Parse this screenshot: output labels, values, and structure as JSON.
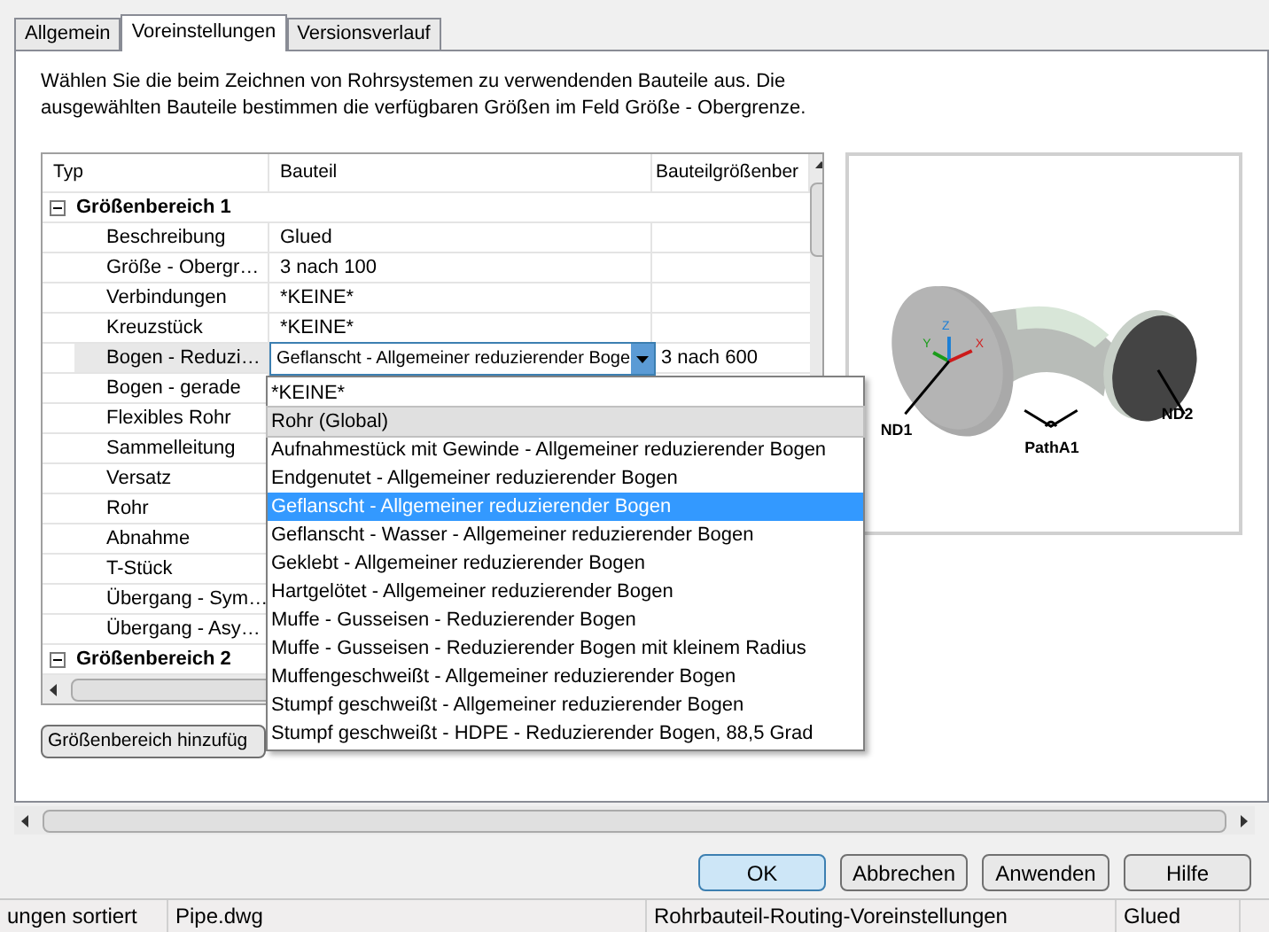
{
  "tabs": [
    {
      "label": "Allgemein",
      "selected": false
    },
    {
      "label": "Voreinstellungen",
      "selected": true
    },
    {
      "label": "Versionsverlauf",
      "selected": false
    }
  ],
  "description": "Wählen Sie die beim Zeichnen von Rohrsystemen zu verwendenden Bauteile aus. Die ausgewählten Bauteile bestimmen die verfügbaren Größen im Feld Größe - Obergrenze.",
  "grid": {
    "columns": [
      "Typ",
      "Bauteil",
      "Bauteilgrößenber"
    ],
    "groups": [
      {
        "label": "Größenbereich 1",
        "expanded": true,
        "rows": [
          {
            "type": "Beschreibung",
            "part": "Glued",
            "selected": false
          },
          {
            "type": "Größe - Obergr…",
            "part": "3 nach 100",
            "selected": false
          },
          {
            "type": "Verbindungen",
            "part": "*KEINE*",
            "selected": false
          },
          {
            "type": "Kreuzstück",
            "part": "*KEINE*",
            "selected": false
          },
          {
            "type": "Bogen - Reduzi…",
            "part": "Geflanscht - Allgemeiner reduzierender Boge",
            "range": "3 nach 600",
            "selected": true
          },
          {
            "type": "Bogen - gerade",
            "selected": false
          },
          {
            "type": "Flexibles Rohr",
            "selected": false
          },
          {
            "type": "Sammelleitung",
            "selected": false
          },
          {
            "type": "Versatz",
            "selected": false
          },
          {
            "type": "Rohr",
            "selected": false
          },
          {
            "type": "Abnahme",
            "selected": false
          },
          {
            "type": "T-Stück",
            "selected": false
          },
          {
            "type": "Übergang - Sym…",
            "selected": false
          },
          {
            "type": "Übergang - Asy…",
            "selected": false
          }
        ]
      },
      {
        "label": "Größenbereich 2",
        "expanded": true
      }
    ]
  },
  "dropdown": [
    {
      "label": "*KEINE*",
      "selected": false,
      "hovered": false
    },
    {
      "label": "Rohr (Global)",
      "selected": false,
      "hovered": true
    },
    {
      "label": "Aufnahmestück mit Gewinde - Allgemeiner reduzierender Bogen",
      "selected": false,
      "hovered": false
    },
    {
      "label": "Endgenutet - Allgemeiner reduzierender Bogen",
      "selected": false,
      "hovered": false
    },
    {
      "label": "Geflanscht - Allgemeiner reduzierender Bogen",
      "selected": true,
      "hovered": false
    },
    {
      "label": "Geflanscht - Wasser - Allgemeiner reduzierender Bogen",
      "selected": false,
      "hovered": false
    },
    {
      "label": "Geklebt - Allgemeiner reduzierender Bogen",
      "selected": false,
      "hovered": false
    },
    {
      "label": "Hartgelötet - Allgemeiner reduzierender Bogen",
      "selected": false,
      "hovered": false
    },
    {
      "label": "Muffe - Gusseisen - Reduzierender Bogen",
      "selected": false,
      "hovered": false
    },
    {
      "label": "Muffe - Gusseisen - Reduzierender Bogen mit kleinem Radius",
      "selected": false,
      "hovered": false
    },
    {
      "label": "Muffengeschweißt - Allgemeiner reduzierender Bogen",
      "selected": false,
      "hovered": false
    },
    {
      "label": "Stumpf geschweißt - Allgemeiner reduzierender Bogen",
      "selected": false,
      "hovered": false
    },
    {
      "label": "Stumpf geschweißt - HDPE - Reduzierender Bogen, 88,5 Grad",
      "selected": false,
      "hovered": false
    }
  ],
  "preview": {
    "axes": [
      "X",
      "Y",
      "Z"
    ],
    "labels": [
      "ND1",
      "ND2",
      "PathA1"
    ]
  },
  "add_button": "Größenbereich hinzufüg",
  "buttons": [
    {
      "label": "OK",
      "default": true
    },
    {
      "label": "Abbrechen",
      "default": false
    },
    {
      "label": "Anwenden",
      "default": false
    },
    {
      "label": "Hilfe",
      "default": false
    }
  ],
  "status_bar": [
    "ungen sortiert",
    "Pipe.dwg",
    "Rohrbauteil-Routing-Voreinstellungen",
    "Glued"
  ]
}
